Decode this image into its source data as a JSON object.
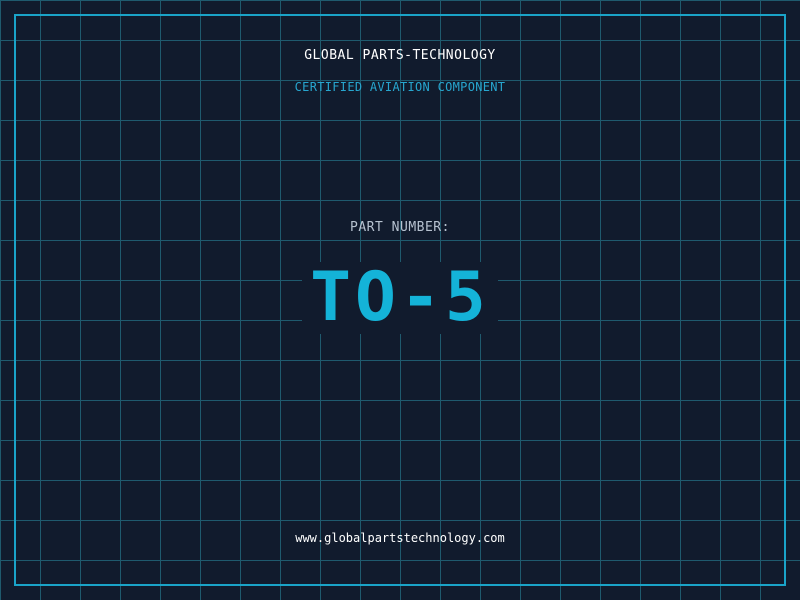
{
  "header": {
    "company_name": "GLOBAL PARTS-TECHNOLOGY",
    "tagline": "CERTIFIED AVIATION COMPONENT"
  },
  "part": {
    "label": "PART NUMBER:",
    "number": "TO-5"
  },
  "footer": {
    "website": "www.globalpartstechnology.com"
  },
  "colors": {
    "background": "#111b2d",
    "grid": "#1f5a6e",
    "accent": "#14b3d8",
    "frame": "#1aa3c8",
    "text": "#ffffff",
    "label": "#b7c2d0"
  }
}
